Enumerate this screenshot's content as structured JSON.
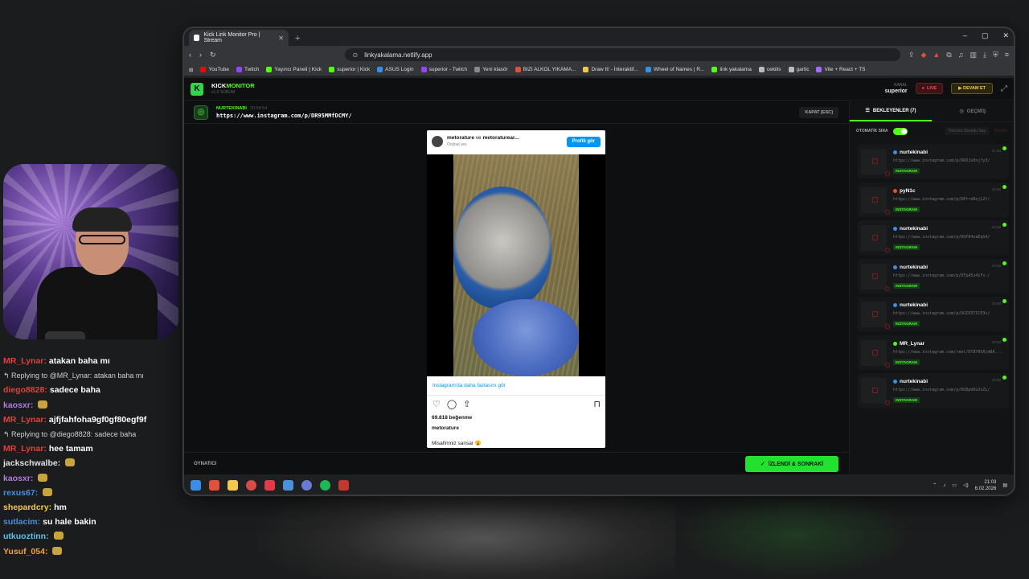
{
  "browser": {
    "tab_title": "Kick Link Monitor Pro | Stream",
    "url": "linkyakalama.netlify.app",
    "bookmarks": [
      {
        "label": "YouTube",
        "color": "#ff0000"
      },
      {
        "label": "Twitch",
        "color": "#9146ff"
      },
      {
        "label": "Yayıncı Paneli | Kick",
        "color": "#53fc18"
      },
      {
        "label": "superior | Kick",
        "color": "#53fc18"
      },
      {
        "label": "ASUS Login",
        "color": "#3a8ee6"
      },
      {
        "label": "superior - Twitch",
        "color": "#9146ff"
      },
      {
        "label": "Yeni klasör",
        "color": "#888888"
      },
      {
        "label": "BIZI ALKOL YIKAMA...",
        "color": "#e0513a"
      },
      {
        "label": "Draw It! - İnteraktif...",
        "color": "#f2c94c"
      },
      {
        "label": "Wheel of Names | R...",
        "color": "#3a8ee6"
      },
      {
        "label": "link yakalama",
        "color": "#53fc18"
      },
      {
        "label": "cekilis",
        "color": "#bbbbbb"
      },
      {
        "label": "gartic",
        "color": "#bbbbbb"
      },
      {
        "label": "Vite + React + TS",
        "color": "#a56bff"
      }
    ]
  },
  "app": {
    "logo_letter": "K",
    "brand_kick": "KICK",
    "brand_monitor": "MONITOR",
    "version": "v1.0 SÜRÜM",
    "channel_label": "KANAL",
    "channel_name": "superior",
    "live_label": "LIVE",
    "continue_label": "DEVAM ET"
  },
  "current": {
    "username": "NURTEKINABI",
    "time": "20:58:54",
    "link": "https://www.instagram.com/p/DR95MMfDCMY/",
    "close_label": "KAPAT [ESC]",
    "player_label": "OYNATICI",
    "next_label": "İZLENDİ & SONRAKİ"
  },
  "instagram": {
    "author": "metorature",
    "connector": "ve",
    "coauthor": "metoraturear...",
    "sound": "Orijinal ses",
    "profile_button": "Profili gör",
    "see_more": "Instagram'da daha fazlasını gör",
    "likes": "69.818 beğenme",
    "caption_user": "metorature",
    "caption": "Misafirimiz sansar 😮"
  },
  "side": {
    "tab_waiting": "BEKLEYENLER (7)",
    "tab_history": "GEÇMİŞ",
    "auto_label": "OTOMATİK SIRA",
    "mark_all": "Tümünü Okundu Say",
    "clear": "Temizle",
    "tag": "INSTAGRAM",
    "queue": [
      {
        "user": "nurtekinabi",
        "link": "https://www.instagram.com/p/DRXJv6nj7y3/",
        "time": "21:00",
        "dot": "#3a8ee6"
      },
      {
        "user": "pyN1c",
        "link": "https://www.instagram.com/p/DPtreNzjL2f/",
        "time": "20:59",
        "dot": "#e0513a"
      },
      {
        "user": "nurtekinabi",
        "link": "https://www.instagram.com/p/DGF84zaEqhA/",
        "time": "20:59",
        "dot": "#3a8ee6"
      },
      {
        "user": "nurtekinabi",
        "link": "https://www.instagram.com/p/DTpA5s4iFx-/",
        "time": "20:59",
        "dot": "#3a8ee6"
      },
      {
        "user": "nurtekinabi",
        "link": "https://www.instagram.com/p/DGIRSTICE3s/",
        "time": "20:59",
        "dot": "#3a8ee6"
      },
      {
        "user": "MR_Lynar",
        "link": "https://www.instagram.com/reel/DT8Y9SAjd0A...",
        "time": "20:58",
        "dot": "#53fc18"
      },
      {
        "user": "nurtekinabi",
        "link": "https://www.instagram.com/p/DU8pU0LOsZL/",
        "time": "20:58",
        "dot": "#3a8ee6"
      }
    ]
  },
  "taskbar": {
    "time": "21:03",
    "date": "6.02.2026"
  },
  "chat": [
    {
      "type": "msg",
      "user": "MR_Lynar:",
      "text": "atakan baha mı",
      "color": "#e0413a"
    },
    {
      "type": "reply",
      "text": "Replying to @MR_Lynar: atakan baha mı"
    },
    {
      "type": "msg",
      "user": "diego8828:",
      "text": "sadece baha",
      "color": "#e0413a"
    },
    {
      "type": "msg",
      "user": "kaosxr:",
      "text": "",
      "color": "#b07be0",
      "emote": true
    },
    {
      "type": "msg",
      "user": "MR_Lynar:",
      "text": "ajfjfahfoha9gf0gf80egf9f",
      "color": "#e0413a"
    },
    {
      "type": "reply",
      "text": "Replying to @diego8828: sadece baha"
    },
    {
      "type": "msg",
      "user": "MR_Lynar:",
      "text": "hee tamam",
      "color": "#e0413a"
    },
    {
      "type": "msg",
      "user": "jackschwalbe:",
      "text": "",
      "color": "#e0e0e0",
      "emote": true
    },
    {
      "type": "msg",
      "user": "kaosxr:",
      "text": "",
      "color": "#b07be0",
      "emote": true
    },
    {
      "type": "msg",
      "user": "rexus67:",
      "text": "",
      "color": "#4a8fe0",
      "emote": true
    },
    {
      "type": "msg",
      "user": "shepardcry:",
      "text": "hm",
      "color": "#f2c94c"
    },
    {
      "type": "msg",
      "user": "sutlacim:",
      "text": "su hale bakin",
      "color": "#4a8fe0"
    },
    {
      "type": "msg",
      "user": "utkuoztinn:",
      "text": "",
      "color": "#59c3e8",
      "emote": true
    },
    {
      "type": "msg",
      "user": "Yusuf_054:",
      "text": "",
      "color": "#f2a23a",
      "emote": true
    }
  ]
}
